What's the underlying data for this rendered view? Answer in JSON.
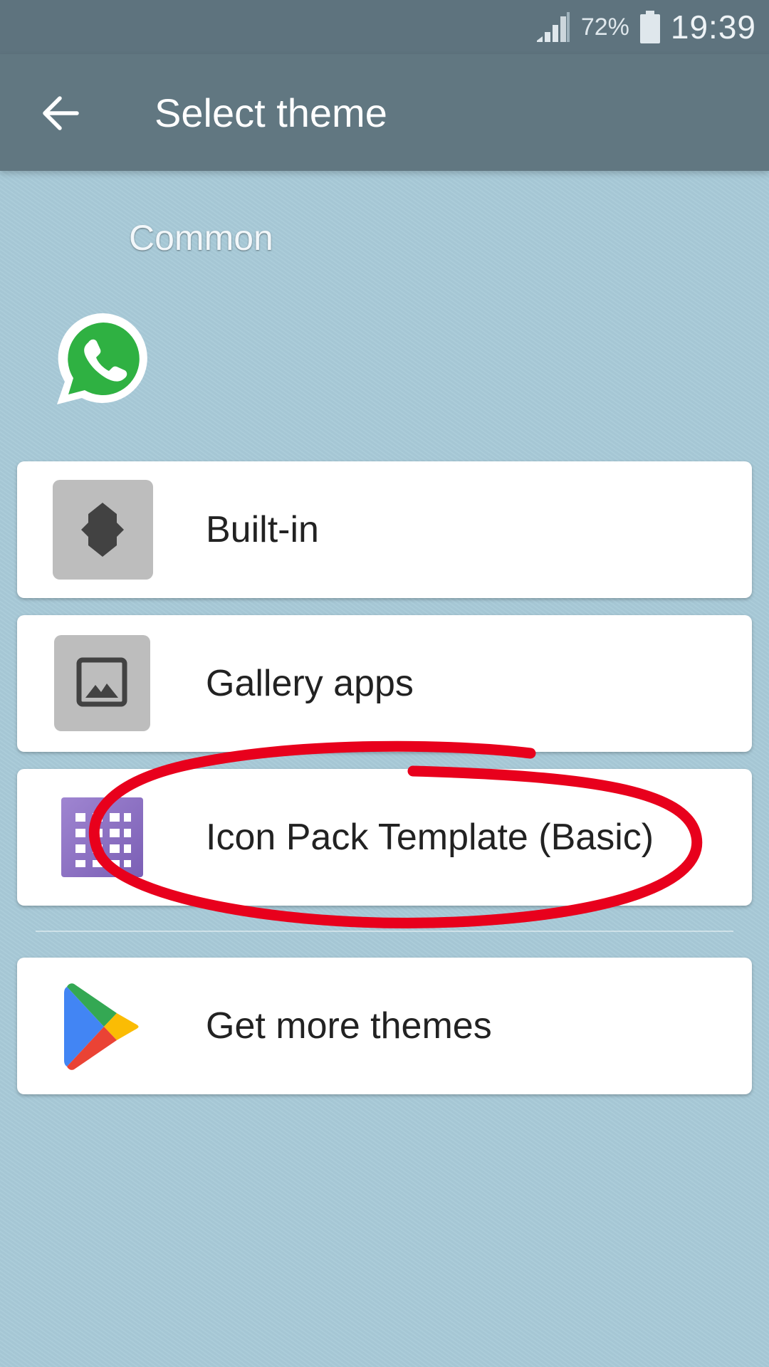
{
  "status_bar": {
    "battery_percent": "72%",
    "time": "19:39",
    "icons": [
      "signal-icon",
      "battery-icon"
    ]
  },
  "app_bar": {
    "title": "Select theme",
    "back_icon": "arrow-left-icon"
  },
  "section": {
    "label": "Common",
    "app_icon": "whatsapp-icon"
  },
  "themes": [
    {
      "label": "Built-in",
      "icon": "builtin-theme-icon"
    },
    {
      "label": "Gallery apps",
      "icon": "gallery-icon"
    },
    {
      "label": "Icon Pack Template (Basic)",
      "icon": "icon-pack-grid-icon"
    }
  ],
  "more": {
    "label": "Get more themes",
    "icon": "play-store-icon"
  },
  "colors": {
    "app_bar": "#617781",
    "background": "#a8cad8",
    "annotation": "#e8001c"
  }
}
